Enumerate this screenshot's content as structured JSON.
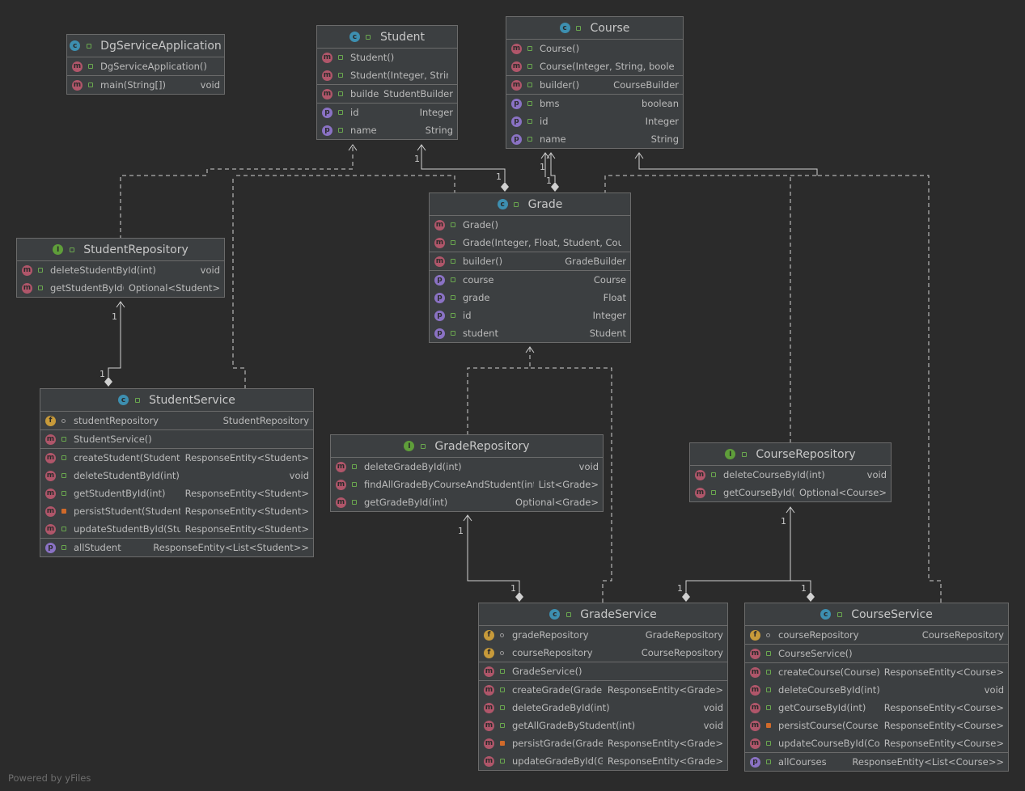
{
  "footer": "Powered by yFiles",
  "multiplicity": "1",
  "classes": [
    {
      "id": "dgservice",
      "name": "DgServiceApplication",
      "kind": "c",
      "sections": [
        [
          {
            "k": "m",
            "v": "pub",
            "name": "DgServiceApplication()",
            "type": ""
          }
        ],
        [
          {
            "k": "m",
            "v": "pub",
            "name": "main(String[])",
            "type": "void"
          }
        ]
      ]
    },
    {
      "id": "student",
      "name": "Student",
      "kind": "c",
      "sections": [
        [
          {
            "k": "m",
            "v": "pub",
            "name": "Student()",
            "type": ""
          },
          {
            "k": "m",
            "v": "pub",
            "name": "Student(Integer, String)",
            "type": ""
          }
        ],
        [
          {
            "k": "m",
            "v": "pub",
            "name": "builder()",
            "type": "StudentBuilder"
          }
        ],
        [
          {
            "k": "p",
            "v": "pub",
            "name": "id",
            "type": "Integer"
          },
          {
            "k": "p",
            "v": "pub",
            "name": "name",
            "type": "String"
          }
        ]
      ]
    },
    {
      "id": "course",
      "name": "Course",
      "kind": "c",
      "sections": [
        [
          {
            "k": "m",
            "v": "pub",
            "name": "Course()",
            "type": ""
          },
          {
            "k": "m",
            "v": "pub",
            "name": "Course(Integer, String, boolean)",
            "type": ""
          }
        ],
        [
          {
            "k": "m",
            "v": "pub",
            "name": "builder()",
            "type": "CourseBuilder"
          }
        ],
        [
          {
            "k": "p",
            "v": "pub",
            "name": "bms",
            "type": "boolean"
          },
          {
            "k": "p",
            "v": "pub",
            "name": "id",
            "type": "Integer"
          },
          {
            "k": "p",
            "v": "pub",
            "name": "name",
            "type": "String"
          }
        ]
      ]
    },
    {
      "id": "grade",
      "name": "Grade",
      "kind": "c",
      "sections": [
        [
          {
            "k": "m",
            "v": "pub",
            "name": "Grade()",
            "type": ""
          },
          {
            "k": "m",
            "v": "pub",
            "name": "Grade(Integer, Float, Student, Course)",
            "type": ""
          }
        ],
        [
          {
            "k": "m",
            "v": "pub",
            "name": "builder()",
            "type": "GradeBuilder"
          }
        ],
        [
          {
            "k": "p",
            "v": "pub",
            "name": "course",
            "type": "Course"
          },
          {
            "k": "p",
            "v": "pub",
            "name": "grade",
            "type": "Float"
          },
          {
            "k": "p",
            "v": "pub",
            "name": "id",
            "type": "Integer"
          },
          {
            "k": "p",
            "v": "pub",
            "name": "student",
            "type": "Student"
          }
        ]
      ]
    },
    {
      "id": "studentrepo",
      "name": "StudentRepository",
      "kind": "i",
      "sections": [
        [
          {
            "k": "m",
            "v": "pub",
            "name": "deleteStudentById(int)",
            "type": "void"
          },
          {
            "k": "m",
            "v": "pub",
            "name": "getStudentById(int)",
            "type": "Optional<Student>"
          }
        ]
      ]
    },
    {
      "id": "studentservice",
      "name": "StudentService",
      "kind": "c",
      "sections": [
        [
          {
            "k": "f",
            "v": "pkg",
            "name": "studentRepository",
            "type": "StudentRepository"
          }
        ],
        [
          {
            "k": "m",
            "v": "pub",
            "name": "StudentService()",
            "type": ""
          }
        ],
        [
          {
            "k": "m",
            "v": "pub",
            "name": "createStudent(Student)",
            "type": "ResponseEntity<Student>"
          },
          {
            "k": "m",
            "v": "pub",
            "name": "deleteStudentById(int)",
            "type": "void"
          },
          {
            "k": "m",
            "v": "pub",
            "name": "getStudentById(int)",
            "type": "ResponseEntity<Student>"
          },
          {
            "k": "m",
            "v": "priv",
            "name": "persistStudent(Student)",
            "type": "ResponseEntity<Student>"
          },
          {
            "k": "m",
            "v": "pub",
            "name": "updateStudentById(Student)",
            "type": "ResponseEntity<Student>"
          }
        ],
        [
          {
            "k": "p",
            "v": "pub",
            "name": "allStudent",
            "type": "ResponseEntity<List<Student>>"
          }
        ]
      ]
    },
    {
      "id": "graderepo",
      "name": "GradeRepository",
      "kind": "i",
      "sections": [
        [
          {
            "k": "m",
            "v": "pub",
            "name": "deleteGradeById(int)",
            "type": "void"
          },
          {
            "k": "m",
            "v": "pub",
            "name": "findAllGradeByCourseAndStudent(int, int)",
            "type": "List<Grade>"
          },
          {
            "k": "m",
            "v": "pub",
            "name": "getGradeById(int)",
            "type": "Optional<Grade>"
          }
        ]
      ]
    },
    {
      "id": "courserepo",
      "name": "CourseRepository",
      "kind": "i",
      "sections": [
        [
          {
            "k": "m",
            "v": "pub",
            "name": "deleteCourseById(int)",
            "type": "void"
          },
          {
            "k": "m",
            "v": "pub",
            "name": "getCourseById(int)",
            "type": "Optional<Course>"
          }
        ]
      ]
    },
    {
      "id": "gradeservice",
      "name": "GradeService",
      "kind": "c",
      "sections": [
        [
          {
            "k": "f",
            "v": "pkg",
            "name": "gradeRepository",
            "type": "GradeRepository"
          },
          {
            "k": "f",
            "v": "pkg",
            "name": "courseRepository",
            "type": "CourseRepository"
          }
        ],
        [
          {
            "k": "m",
            "v": "pub",
            "name": "GradeService()",
            "type": ""
          }
        ],
        [
          {
            "k": "m",
            "v": "pub",
            "name": "createGrade(Grade)",
            "type": "ResponseEntity<Grade>"
          },
          {
            "k": "m",
            "v": "pub",
            "name": "deleteGradeById(int)",
            "type": "void"
          },
          {
            "k": "m",
            "v": "pub",
            "name": "getAllGradeByStudent(int)",
            "type": "void"
          },
          {
            "k": "m",
            "v": "priv",
            "name": "persistGrade(Grade)",
            "type": "ResponseEntity<Grade>"
          },
          {
            "k": "m",
            "v": "pub",
            "name": "updateGradeById(Grade)",
            "type": "ResponseEntity<Grade>"
          }
        ]
      ]
    },
    {
      "id": "courseservice",
      "name": "CourseService",
      "kind": "c",
      "sections": [
        [
          {
            "k": "f",
            "v": "pkg",
            "name": "courseRepository",
            "type": "CourseRepository"
          }
        ],
        [
          {
            "k": "m",
            "v": "pub",
            "name": "CourseService()",
            "type": ""
          }
        ],
        [
          {
            "k": "m",
            "v": "pub",
            "name": "createCourse(Course)",
            "type": "ResponseEntity<Course>"
          },
          {
            "k": "m",
            "v": "pub",
            "name": "deleteCourseById(int)",
            "type": "void"
          },
          {
            "k": "m",
            "v": "pub",
            "name": "getCourseById(int)",
            "type": "ResponseEntity<Course>"
          },
          {
            "k": "m",
            "v": "priv",
            "name": "persistCourse(Course)",
            "type": "ResponseEntity<Course>"
          },
          {
            "k": "m",
            "v": "pub",
            "name": "updateCourseById(Course)",
            "type": "ResponseEntity<Course>"
          }
        ],
        [
          {
            "k": "p",
            "v": "pub",
            "name": "allCourses",
            "type": "ResponseEntity<List<Course>>"
          }
        ]
      ]
    }
  ]
}
